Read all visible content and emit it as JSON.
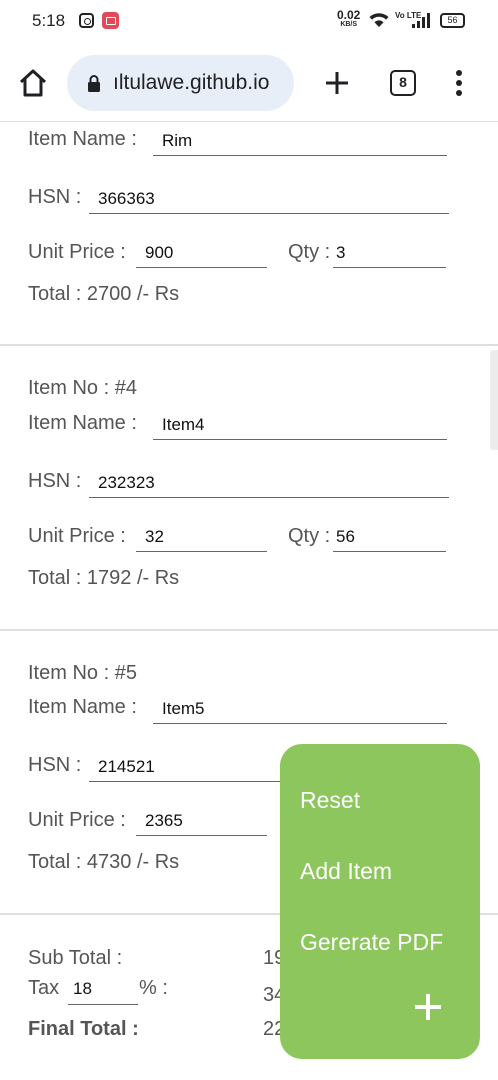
{
  "status_bar": {
    "time": "5:18",
    "speed_value": "0.02",
    "speed_unit": "KB/S",
    "volte": "Vo LTE",
    "battery": "56"
  },
  "browser": {
    "url": "ıltulawe.github.io",
    "tab_count": "8"
  },
  "form": {
    "item3": {
      "name_label": "Item Name :",
      "name_value": "Rim",
      "hsn_label": "HSN :",
      "hsn_value": "366363",
      "price_label": "Unit Price :",
      "price_value": "900",
      "qty_label": "Qty :",
      "qty_value": "3",
      "total_text": "Total : 2700 /- Rs"
    },
    "item4": {
      "no_text": "Item No : #4",
      "name_label": "Item Name :",
      "name_value": "Item4",
      "hsn_label": "HSN :",
      "hsn_value": "232323",
      "price_label": "Unit Price :",
      "price_value": "32",
      "qty_label": "Qty :",
      "qty_value": "56",
      "total_text": "Total : 1792 /- Rs"
    },
    "item5": {
      "no_text": "Item No : #5",
      "name_label": "Item Name :",
      "name_value": "Item5",
      "hsn_label": "HSN :",
      "hsn_value": "214521",
      "price_label": "Unit Price :",
      "price_value": "2365",
      "total_text": "Total : 4730 /- Rs"
    },
    "summary": {
      "subtotal_label": "Sub Total :",
      "subtotal_value": "19",
      "tax_label": "Tax",
      "tax_value": "18",
      "tax_percent": "% :",
      "tax_amount": "34",
      "final_label": "Final Total :",
      "final_value": "22"
    }
  },
  "fab_menu": {
    "reset": "Reset",
    "add_item": "Add Item",
    "generate_pdf": "Gererate PDF"
  },
  "colors": {
    "fab_green": "#8cc65c",
    "url_pill": "#e8eef7",
    "record_badge": "#e24a5a"
  },
  "icons": [
    "instagram-icon",
    "screen-record-icon",
    "wifi-icon",
    "signal-icon",
    "battery-icon",
    "home-icon",
    "lock-icon",
    "plus-icon",
    "tabs-icon",
    "overflow-menu-icon"
  ]
}
